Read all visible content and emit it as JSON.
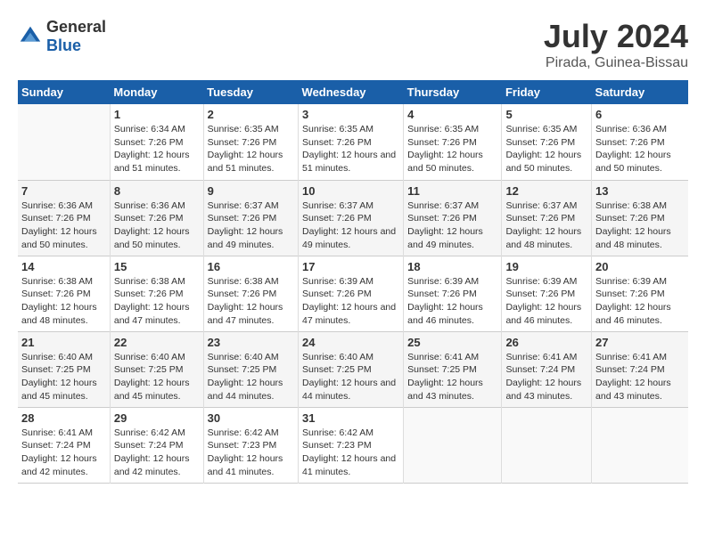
{
  "header": {
    "logo_general": "General",
    "logo_blue": "Blue",
    "month_year": "July 2024",
    "location": "Pirada, Guinea-Bissau"
  },
  "weekdays": [
    "Sunday",
    "Monday",
    "Tuesday",
    "Wednesday",
    "Thursday",
    "Friday",
    "Saturday"
  ],
  "weeks": [
    [
      {
        "day": "",
        "sunrise": "",
        "sunset": "",
        "daylight": ""
      },
      {
        "day": "1",
        "sunrise": "Sunrise: 6:34 AM",
        "sunset": "Sunset: 7:26 PM",
        "daylight": "Daylight: 12 hours and 51 minutes."
      },
      {
        "day": "2",
        "sunrise": "Sunrise: 6:35 AM",
        "sunset": "Sunset: 7:26 PM",
        "daylight": "Daylight: 12 hours and 51 minutes."
      },
      {
        "day": "3",
        "sunrise": "Sunrise: 6:35 AM",
        "sunset": "Sunset: 7:26 PM",
        "daylight": "Daylight: 12 hours and 51 minutes."
      },
      {
        "day": "4",
        "sunrise": "Sunrise: 6:35 AM",
        "sunset": "Sunset: 7:26 PM",
        "daylight": "Daylight: 12 hours and 50 minutes."
      },
      {
        "day": "5",
        "sunrise": "Sunrise: 6:35 AM",
        "sunset": "Sunset: 7:26 PM",
        "daylight": "Daylight: 12 hours and 50 minutes."
      },
      {
        "day": "6",
        "sunrise": "Sunrise: 6:36 AM",
        "sunset": "Sunset: 7:26 PM",
        "daylight": "Daylight: 12 hours and 50 minutes."
      }
    ],
    [
      {
        "day": "7",
        "sunrise": "Sunrise: 6:36 AM",
        "sunset": "Sunset: 7:26 PM",
        "daylight": "Daylight: 12 hours and 50 minutes."
      },
      {
        "day": "8",
        "sunrise": "Sunrise: 6:36 AM",
        "sunset": "Sunset: 7:26 PM",
        "daylight": "Daylight: 12 hours and 50 minutes."
      },
      {
        "day": "9",
        "sunrise": "Sunrise: 6:37 AM",
        "sunset": "Sunset: 7:26 PM",
        "daylight": "Daylight: 12 hours and 49 minutes."
      },
      {
        "day": "10",
        "sunrise": "Sunrise: 6:37 AM",
        "sunset": "Sunset: 7:26 PM",
        "daylight": "Daylight: 12 hours and 49 minutes."
      },
      {
        "day": "11",
        "sunrise": "Sunrise: 6:37 AM",
        "sunset": "Sunset: 7:26 PM",
        "daylight": "Daylight: 12 hours and 49 minutes."
      },
      {
        "day": "12",
        "sunrise": "Sunrise: 6:37 AM",
        "sunset": "Sunset: 7:26 PM",
        "daylight": "Daylight: 12 hours and 48 minutes."
      },
      {
        "day": "13",
        "sunrise": "Sunrise: 6:38 AM",
        "sunset": "Sunset: 7:26 PM",
        "daylight": "Daylight: 12 hours and 48 minutes."
      }
    ],
    [
      {
        "day": "14",
        "sunrise": "Sunrise: 6:38 AM",
        "sunset": "Sunset: 7:26 PM",
        "daylight": "Daylight: 12 hours and 48 minutes."
      },
      {
        "day": "15",
        "sunrise": "Sunrise: 6:38 AM",
        "sunset": "Sunset: 7:26 PM",
        "daylight": "Daylight: 12 hours and 47 minutes."
      },
      {
        "day": "16",
        "sunrise": "Sunrise: 6:38 AM",
        "sunset": "Sunset: 7:26 PM",
        "daylight": "Daylight: 12 hours and 47 minutes."
      },
      {
        "day": "17",
        "sunrise": "Sunrise: 6:39 AM",
        "sunset": "Sunset: 7:26 PM",
        "daylight": "Daylight: 12 hours and 47 minutes."
      },
      {
        "day": "18",
        "sunrise": "Sunrise: 6:39 AM",
        "sunset": "Sunset: 7:26 PM",
        "daylight": "Daylight: 12 hours and 46 minutes."
      },
      {
        "day": "19",
        "sunrise": "Sunrise: 6:39 AM",
        "sunset": "Sunset: 7:26 PM",
        "daylight": "Daylight: 12 hours and 46 minutes."
      },
      {
        "day": "20",
        "sunrise": "Sunrise: 6:39 AM",
        "sunset": "Sunset: 7:26 PM",
        "daylight": "Daylight: 12 hours and 46 minutes."
      }
    ],
    [
      {
        "day": "21",
        "sunrise": "Sunrise: 6:40 AM",
        "sunset": "Sunset: 7:25 PM",
        "daylight": "Daylight: 12 hours and 45 minutes."
      },
      {
        "day": "22",
        "sunrise": "Sunrise: 6:40 AM",
        "sunset": "Sunset: 7:25 PM",
        "daylight": "Daylight: 12 hours and 45 minutes."
      },
      {
        "day": "23",
        "sunrise": "Sunrise: 6:40 AM",
        "sunset": "Sunset: 7:25 PM",
        "daylight": "Daylight: 12 hours and 44 minutes."
      },
      {
        "day": "24",
        "sunrise": "Sunrise: 6:40 AM",
        "sunset": "Sunset: 7:25 PM",
        "daylight": "Daylight: 12 hours and 44 minutes."
      },
      {
        "day": "25",
        "sunrise": "Sunrise: 6:41 AM",
        "sunset": "Sunset: 7:25 PM",
        "daylight": "Daylight: 12 hours and 43 minutes."
      },
      {
        "day": "26",
        "sunrise": "Sunrise: 6:41 AM",
        "sunset": "Sunset: 7:24 PM",
        "daylight": "Daylight: 12 hours and 43 minutes."
      },
      {
        "day": "27",
        "sunrise": "Sunrise: 6:41 AM",
        "sunset": "Sunset: 7:24 PM",
        "daylight": "Daylight: 12 hours and 43 minutes."
      }
    ],
    [
      {
        "day": "28",
        "sunrise": "Sunrise: 6:41 AM",
        "sunset": "Sunset: 7:24 PM",
        "daylight": "Daylight: 12 hours and 42 minutes."
      },
      {
        "day": "29",
        "sunrise": "Sunrise: 6:42 AM",
        "sunset": "Sunset: 7:24 PM",
        "daylight": "Daylight: 12 hours and 42 minutes."
      },
      {
        "day": "30",
        "sunrise": "Sunrise: 6:42 AM",
        "sunset": "Sunset: 7:23 PM",
        "daylight": "Daylight: 12 hours and 41 minutes."
      },
      {
        "day": "31",
        "sunrise": "Sunrise: 6:42 AM",
        "sunset": "Sunset: 7:23 PM",
        "daylight": "Daylight: 12 hours and 41 minutes."
      },
      {
        "day": "",
        "sunrise": "",
        "sunset": "",
        "daylight": ""
      },
      {
        "day": "",
        "sunrise": "",
        "sunset": "",
        "daylight": ""
      },
      {
        "day": "",
        "sunrise": "",
        "sunset": "",
        "daylight": ""
      }
    ]
  ]
}
